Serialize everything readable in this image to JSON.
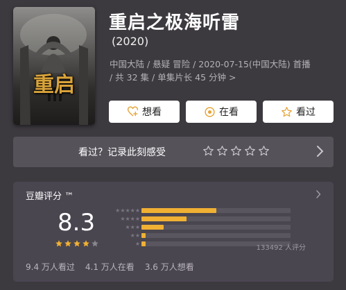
{
  "poster": {
    "logo_text": "重启"
  },
  "title": "重启之极海听雷",
  "year": "(2020)",
  "meta": {
    "line1": "中国大陆 / 悬疑 冒险 / 2020-07-15(中国大陆) 首播",
    "line2": "/ 共 32 集 / 单集片长 45 分钟 >"
  },
  "actions": [
    {
      "label": "想看",
      "icon": "heart-plus-icon"
    },
    {
      "label": "在看",
      "icon": "record-icon"
    },
    {
      "label": "看过",
      "icon": "star-outline-icon"
    }
  ],
  "feeling": {
    "prompt": "看过？记录此刻感受",
    "stars": 5
  },
  "rating": {
    "title": "豆瓣评分 ™",
    "score": "8.3",
    "stars_filled": 4,
    "stars_total": 5,
    "distribution": [
      0.5,
      0.3,
      0.15,
      0.03,
      0.02
    ],
    "raters": "133492 人评分",
    "colors": {
      "bar": "#f0b033",
      "track": "#5a5660"
    }
  },
  "stats": [
    "9.4 万人看过",
    "4.1 万人在看",
    "3.6 万人想看"
  ]
}
